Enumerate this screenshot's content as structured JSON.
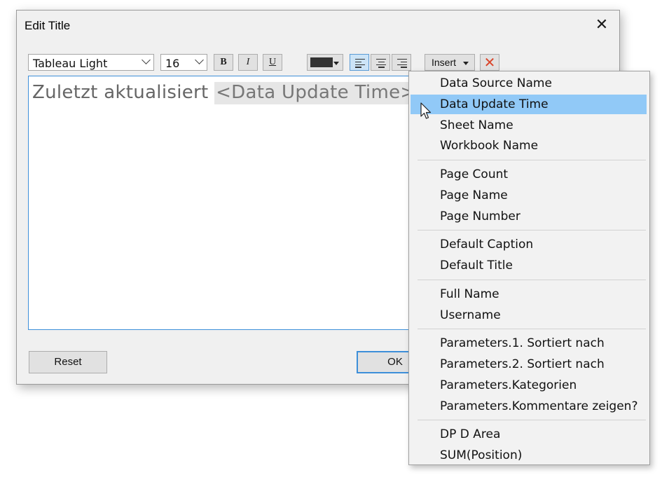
{
  "dialog": {
    "title": "Edit Title",
    "close_glyph": "✕"
  },
  "toolbar": {
    "font_family": "Tableau Light",
    "font_size": "16",
    "bold_label": "B",
    "italic_label": "I",
    "underline_label": "U",
    "text_color": "#333333",
    "align_selected": "left",
    "insert_label": "Insert",
    "delete_glyph": "✕"
  },
  "editor": {
    "static_text": "Zuletzt aktualisiert ",
    "field_token": "<Data Update Time>"
  },
  "buttons": {
    "reset": "Reset",
    "ok": "OK"
  },
  "insert_menu": {
    "hovered": "Data Update Time",
    "groups": [
      [
        "Data Source Name",
        "Data Update Time",
        "Sheet Name",
        "Workbook Name"
      ],
      [
        "Page Count",
        "Page Name",
        "Page Number"
      ],
      [
        "Default Caption",
        "Default Title"
      ],
      [
        "Full Name",
        "Username"
      ],
      [
        "Parameters.1. Sortiert nach",
        "Parameters.2. Sortiert nach",
        "Parameters.Kategorien",
        "Parameters.Kommentare zeigen?"
      ],
      [
        "DP D Area",
        "SUM(Position)"
      ]
    ]
  },
  "colors": {
    "accent": "#3d8fd9",
    "menu_hover": "#91c9f7",
    "delete_red": "#d9452b"
  }
}
